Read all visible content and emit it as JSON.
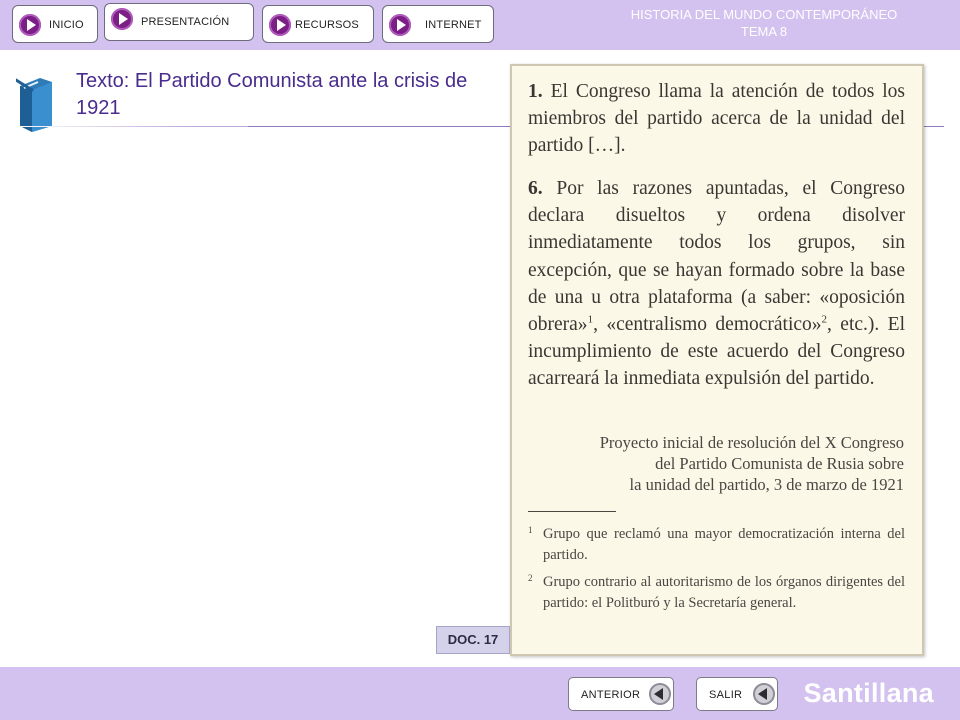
{
  "nav": {
    "inicio": "INICIO",
    "presentacion": "PRESENTACIÓN",
    "recursos": "RECURSOS",
    "internet": "INTERNET"
  },
  "header": {
    "line1": "HISTORIA DEL MUNDO CONTEMPORÁNEO",
    "line2": "TEMA 8"
  },
  "page": {
    "title": "Texto: El Partido Comunista ante la crisis de 1921",
    "icon": "book-icon"
  },
  "document": {
    "p1_num": "1.",
    "p1_text": "El Congreso llama la atención de todos los miembros del partido acerca de la unidad del partido […].",
    "p2_num": "6.",
    "p2_text_a": "Por las razones apuntadas, el Congreso declara disueltos y ordena disolver inmediatamente todos los grupos, sin excepción, que se hayan formado sobre la base de una u otra plataforma (a saber: «oposición obrera»",
    "p2_sup1": "1",
    "p2_text_b": ", «centralismo democrático»",
    "p2_sup2": "2",
    "p2_text_c": ", etc.). El incumplimiento de este acuerdo del Congreso acarreará la inmediata expulsión del partido.",
    "source_1": "Proyecto inicial de resolución del X Congreso",
    "source_2": "del Partido Comunista de Rusia sobre",
    "source_3": "la unidad del partido, 3 de marzo de 1921",
    "fn1_num": "1",
    "fn1_text": "Grupo que reclamó una mayor democratización interna del partido.",
    "fn2_num": "2",
    "fn2_text": "Grupo contrario al autoritarismo de los órganos dirigentes del partido: el Politburó y la Secretaría general.",
    "badge": "DOC. 17"
  },
  "footer": {
    "anterior": "ANTERIOR",
    "salir": "SALIR",
    "brand": "Santillana"
  },
  "colors": {
    "bar": "#d3c2ef",
    "title": "#4a2c8c",
    "play": "#7b1f86",
    "paper": "#fbf8e8"
  }
}
